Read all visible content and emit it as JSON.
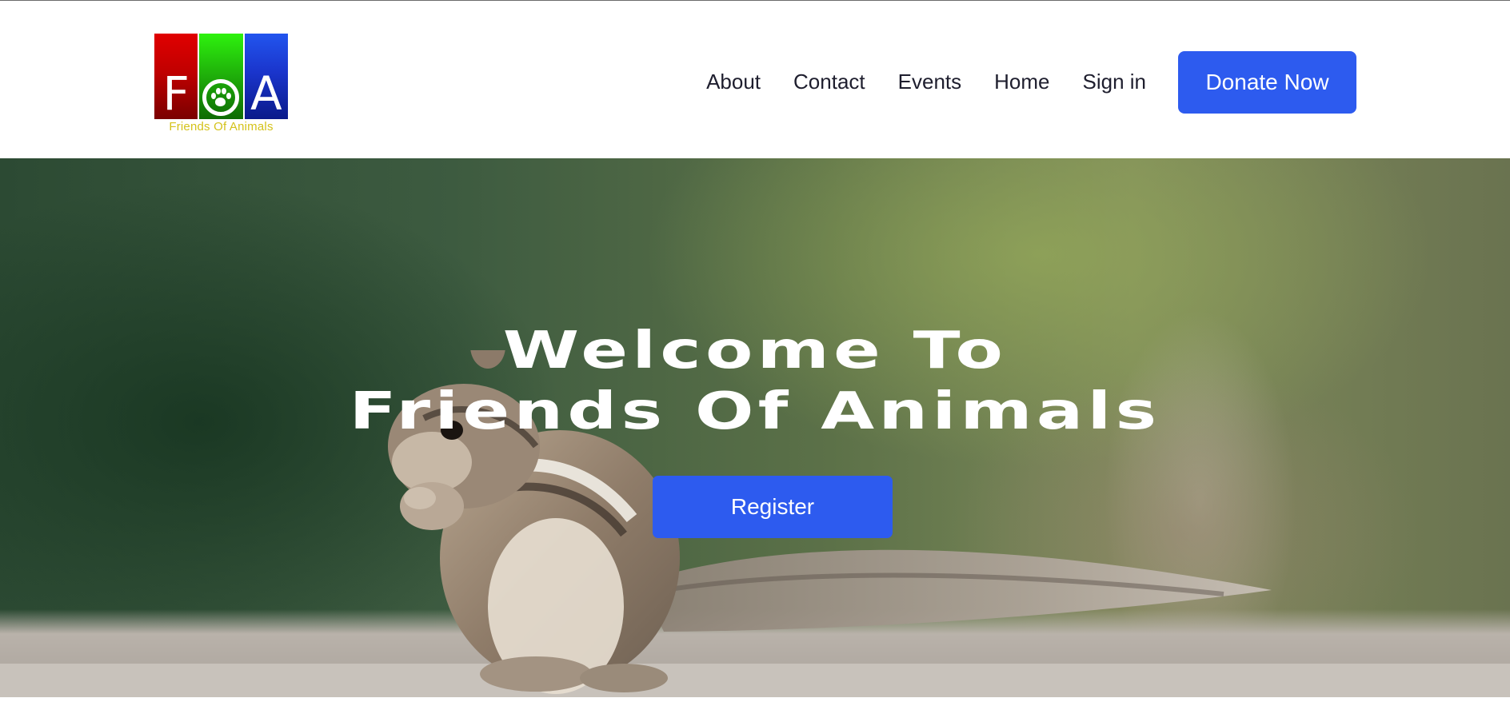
{
  "brand": {
    "logo_letters": [
      "F",
      "O",
      "A"
    ],
    "logo_tagline": "Friends Of Animals",
    "colors": {
      "red": "#c00000",
      "green": "#20b40a",
      "blue": "#1a35cc",
      "tagline": "#d4c21a"
    }
  },
  "nav": {
    "items": [
      {
        "label": "About"
      },
      {
        "label": "Contact"
      },
      {
        "label": "Events"
      },
      {
        "label": "Home"
      },
      {
        "label": "Sign in"
      }
    ],
    "donate_label": "Donate Now",
    "accent": "#2d5bef"
  },
  "hero": {
    "title_line1": "Welcome To",
    "title_line2": "Friends Of Animals",
    "register_label": "Register",
    "image_subject": "chipmunk-photo"
  }
}
